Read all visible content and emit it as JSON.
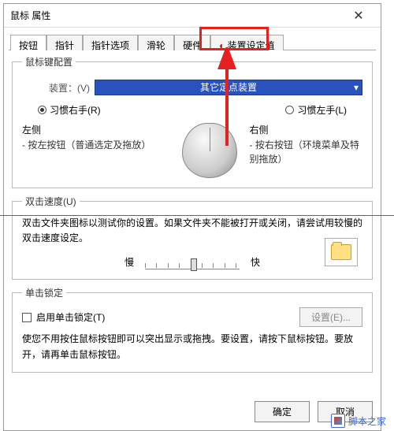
{
  "window": {
    "title": "鼠标 属性"
  },
  "tabs": [
    "按钮",
    "指针",
    "指针选项",
    "滑轮",
    "硬件",
    "装置设定值"
  ],
  "active_tab_index": 0,
  "highlighted_tab_index": 5,
  "config": {
    "legend": "鼠标键配置",
    "device_label": "装置：(V)",
    "device_value": "其它定点装置",
    "right_hand": "习惯右手(R)",
    "left_hand": "习惯左手(L)",
    "hand_selected": "right",
    "left_side": {
      "title": "左侧",
      "desc": "- 按左按钮（普通选定及拖放）"
    },
    "right_side": {
      "title": "右侧",
      "desc": "- 按右按钮（环境菜单及特别拖放）"
    }
  },
  "dclick": {
    "legend": "双击速度(U)",
    "text": "双击文件夹图标以测试你的设置。如果文件夹不能被打开或关闭，请尝试用较慢的双击速度设定。",
    "slow": "慢",
    "fast": "快"
  },
  "lock": {
    "legend": "单击锁定",
    "enable": "启用单击锁定(T)",
    "settings_btn": "设置(E)...",
    "text": "使您不用按住鼠标按钮即可以突出显示或拖拽。要设置，请按下鼠标按钮。要放开，请再单击鼠标按钮。"
  },
  "buttons": {
    "ok": "确定",
    "cancel": "取消"
  },
  "watermark": "脚本之家"
}
